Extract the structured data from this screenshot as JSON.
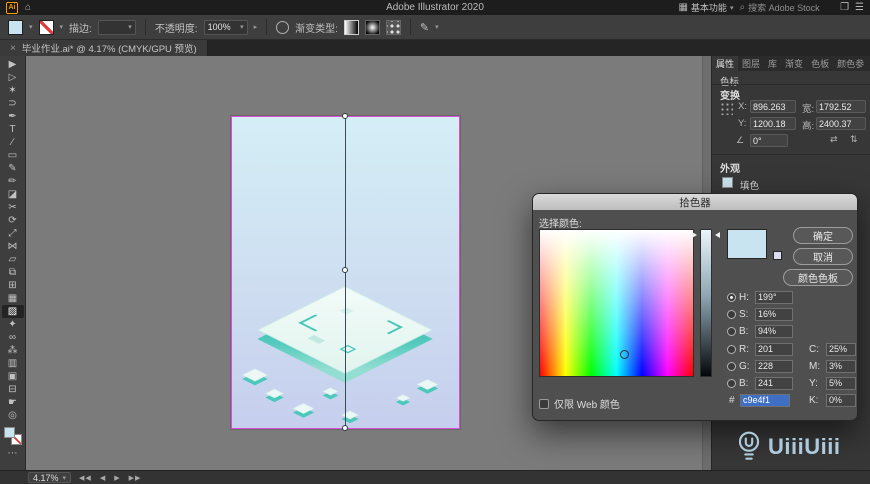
{
  "colors": {
    "accent_fill": "#c9e4f1",
    "selection_magenta": "#dd4fd4",
    "iso_teal": "#4cc8bb",
    "watermark_blue": "#b8d8eb"
  },
  "menubar": {
    "app_badge": "Ai",
    "title": "Adobe Illustrator 2020",
    "workspace_label": "基本功能",
    "search_placeholder": "搜索 Adobe Stock"
  },
  "controlbar": {
    "stroke_label": "描边:",
    "opacity_label": "不透明度:",
    "opacity_value": "100%",
    "gradient_type_label": "渐变类型:"
  },
  "document_tab": {
    "close_glyph": "×",
    "title": "毕业作业.ai* @ 4.17% (CMYK/GPU 预览)"
  },
  "toolbar": {
    "tools": [
      {
        "id": "selection-tool",
        "glyph": "▶"
      },
      {
        "id": "direct-selection-tool",
        "glyph": "▷"
      },
      {
        "id": "magic-wand-tool",
        "glyph": "✶"
      },
      {
        "id": "lasso-tool",
        "glyph": "⊃"
      },
      {
        "id": "pen-tool",
        "glyph": "✒"
      },
      {
        "id": "type-tool",
        "glyph": "T"
      },
      {
        "id": "line-segment-tool",
        "glyph": "∕"
      },
      {
        "id": "rectangle-tool",
        "glyph": "▭"
      },
      {
        "id": "paintbrush-tool",
        "glyph": "✎"
      },
      {
        "id": "pencil-tool",
        "glyph": "✏"
      },
      {
        "id": "eraser-tool",
        "glyph": "◪"
      },
      {
        "id": "scissors-tool",
        "glyph": "✂"
      },
      {
        "id": "rotate-tool",
        "glyph": "⟳"
      },
      {
        "id": "scale-tool",
        "glyph": "⤢"
      },
      {
        "id": "width-tool",
        "glyph": "⋈"
      },
      {
        "id": "free-transform-tool",
        "glyph": "▱"
      },
      {
        "id": "shape-builder-tool",
        "glyph": "⧉"
      },
      {
        "id": "perspective-grid-tool",
        "glyph": "⊞"
      },
      {
        "id": "mesh-tool",
        "glyph": "▦"
      },
      {
        "id": "gradient-tool",
        "glyph": "▨",
        "active": true
      },
      {
        "id": "eyedropper-tool",
        "glyph": "✦"
      },
      {
        "id": "blend-tool",
        "glyph": "∞"
      },
      {
        "id": "symbol-sprayer-tool",
        "glyph": "⁂"
      },
      {
        "id": "column-graph-tool",
        "glyph": "▥"
      },
      {
        "id": "artboard-tool",
        "glyph": "▣"
      },
      {
        "id": "slice-tool",
        "glyph": "⊟"
      },
      {
        "id": "hand-tool",
        "glyph": "☛"
      },
      {
        "id": "zoom-tool",
        "glyph": "◎"
      }
    ]
  },
  "color_picker": {
    "title": "拾色器",
    "select_color_label": "选择颜色:",
    "ok_label": "确定",
    "cancel_label": "取消",
    "swatches_label": "颜色色板",
    "web_only_label": "仅限 Web 颜色",
    "hex_prefix": "#",
    "hex_value": "c9e4f1",
    "preview_color": "#c9e4f1",
    "fields": {
      "h_label": "H:",
      "h_value": "199°",
      "s_label": "S:",
      "s_value": "16%",
      "b_label": "B:",
      "b_value": "94%",
      "r_label": "R:",
      "r_value": "201",
      "g_label": "G:",
      "g_value": "228",
      "b2_label": "B:",
      "b2_value": "241",
      "c_label": "C:",
      "c_value": "25%",
      "m_label": "M:",
      "m_value": "3%",
      "y_label": "Y:",
      "y_value": "5%",
      "k_label": "K:",
      "k_value": "0%"
    }
  },
  "right_panel": {
    "tabs": [
      {
        "id": "properties",
        "label": "属性"
      },
      {
        "id": "layers",
        "label": "图层"
      },
      {
        "id": "libraries",
        "label": "库"
      },
      {
        "id": "gradient",
        "label": "渐变"
      },
      {
        "id": "swatches",
        "label": "色板"
      },
      {
        "id": "color-guide",
        "label": "颜色参"
      }
    ],
    "stops_label": "色标",
    "transform": {
      "title": "变换",
      "x_label": "X:",
      "x_value": "896.263",
      "y_label": "Y:",
      "y_value": "1200.18",
      "w_label": "宽:",
      "w_value": "1792.52",
      "h_label": "高:",
      "h_value": "2400.37",
      "angle_value": "0°"
    },
    "appearance": {
      "title": "外观",
      "fill_label": "填色"
    }
  },
  "statusbar": {
    "zoom_value": "4.17%"
  },
  "watermark": {
    "text": "UiiiUiii"
  }
}
